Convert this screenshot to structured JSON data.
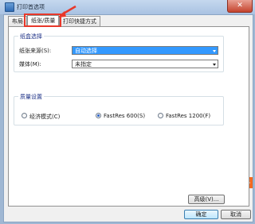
{
  "window": {
    "title": "打印首选项",
    "close_label": "✕"
  },
  "tabs": [
    {
      "label": "布局"
    },
    {
      "label": "纸张/质量"
    },
    {
      "label": "打印快捷方式"
    }
  ],
  "tray_group": {
    "title": "纸盒选择",
    "source_label": "纸张来源(S):",
    "source_value": "自动选择",
    "media_label": "媒体(M):",
    "media_value": "未指定"
  },
  "quality_group": {
    "title": "质量设置",
    "options": [
      {
        "label": "经济模式(C)",
        "checked": false
      },
      {
        "label": "FastRes 600(S)",
        "checked": true
      },
      {
        "label": "FastRes 1200(F)",
        "checked": false
      }
    ]
  },
  "buttons": {
    "advanced": "高级(V)...",
    "ok": "确定",
    "cancel": "取消"
  },
  "colors": {
    "selected_blue": "#3399ff",
    "annotation_red": "#e8382a",
    "logo_orange": "#f26a21"
  },
  "corner_logo": "S"
}
